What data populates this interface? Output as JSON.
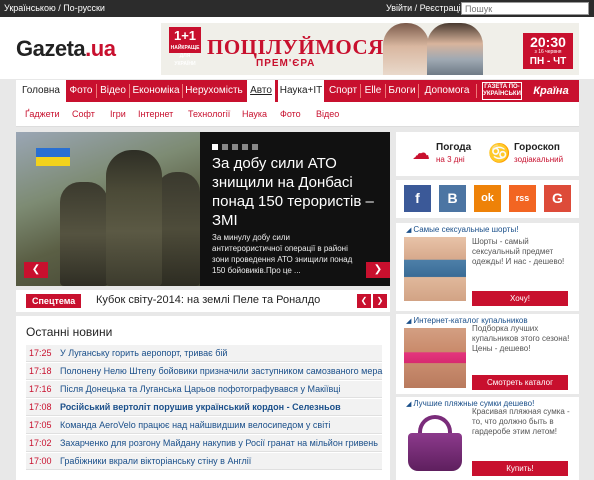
{
  "topbar": {
    "languages": "Українською / По-русски",
    "auth": "Увійти / Реєстрація",
    "search_placeholder": "Пошук"
  },
  "logo": {
    "name": "Gazeta",
    "tld": ".ua"
  },
  "banner": {
    "channel": "1+1",
    "channel_sub": "НАЙКРАЩЕ ДЛЯ УКРАЇНИ",
    "title": "ПОЦІЛУЙМОСЯ",
    "subtitle": "ПРЕМ'ЄРА",
    "time": "20:30",
    "dates": "з 16 червня",
    "days": "ПН - ЧТ"
  },
  "nav": {
    "items": [
      "Головна",
      "Фото",
      "Відео",
      "Економіка",
      "Нерухомість",
      "Авто",
      "Наука+IT",
      "Спорт",
      "Elle",
      "Блоги",
      "Допомога"
    ],
    "brand1": "ГАЗЕТА ПО-УКРАЇНСЬКИ",
    "brand2": "Країна"
  },
  "subnav": {
    "items": [
      "Ґаджети",
      "Софт",
      "Ігри",
      "Інтернет",
      "Технології",
      "Наука",
      "Фото",
      "Відео"
    ]
  },
  "hero": {
    "headline": "За добу сили АТО знищили на Донбасі понад 150 терористів – ЗМІ",
    "lead": "За минулу добу сили антитерористичної операції в районі зони проведення АТО знищили понад 150 бойовиків.Про це ...",
    "prev": "❮",
    "next": "❯"
  },
  "special": {
    "label": "Спецтема",
    "text": "Кубок світу-2014: на землі Пеле та Роналдо",
    "prev": "❮",
    "next": "❯"
  },
  "news": {
    "title": "Останні новини",
    "items": [
      {
        "time": "17:25",
        "text": "У Луганську горить аеропорт, триває бій",
        "bold": false
      },
      {
        "time": "17:18",
        "text": "Полонену Нелю Штепу бойовики призначили заступником самозваного мера",
        "bold": false
      },
      {
        "time": "17:16",
        "text": "Після Донецька та Луганська Царьов пофотографувався у Макіївці",
        "bold": false
      },
      {
        "time": "17:08",
        "text": "Російський вертоліт порушив український кордон - Селезньов",
        "bold": true
      },
      {
        "time": "17:05",
        "text": "Команда AeroVelo працює над найшвидшим велосипедом у світі",
        "bold": false
      },
      {
        "time": "17:02",
        "text": "Захарченко для розгону Майдану накупив у Росії гранат на мільйон гривень",
        "bold": false
      },
      {
        "time": "17:00",
        "text": "Грабіжники вкрали вікторіанську стіну в Англії",
        "bold": false
      }
    ]
  },
  "widgets": {
    "weather_title": "Погода",
    "weather_sub": "на 3 дні",
    "horoscope_title": "Гороскоп",
    "horoscope_sub": "зодіакальний"
  },
  "social": {
    "items": [
      {
        "label": "f",
        "color": "#3b5998",
        "icon": "facebook-icon"
      },
      {
        "label": "В",
        "color": "#4c75a3",
        "icon": "vk-icon"
      },
      {
        "label": "ok",
        "color": "#ee8208",
        "icon": "odnoklassniki-icon"
      },
      {
        "label": "rss",
        "color": "#f26522",
        "icon": "rss-icon"
      },
      {
        "label": "G",
        "color": "#dd4b39",
        "icon": "google-plus-icon"
      }
    ]
  },
  "ads": [
    {
      "title": "Самые сексуальные шорты!",
      "desc": "Шорты - самый сексуальный предмет одежды! И нас - дешево!",
      "cta": "Хочу!"
    },
    {
      "title": "Интернет-каталог купальников",
      "desc": "Подборка лучших купальников этого сезона! Цены - дешево!",
      "cta": "Смотреть каталог"
    },
    {
      "title": "Лучшие пляжные сумки дешево!",
      "desc": "Красивая пляжная сумка - то, что должно быть в гардеробе этим летом!",
      "cta": "Купить!"
    }
  ],
  "colors": {
    "accent": "#c8102e",
    "link": "#1a4f8a"
  }
}
